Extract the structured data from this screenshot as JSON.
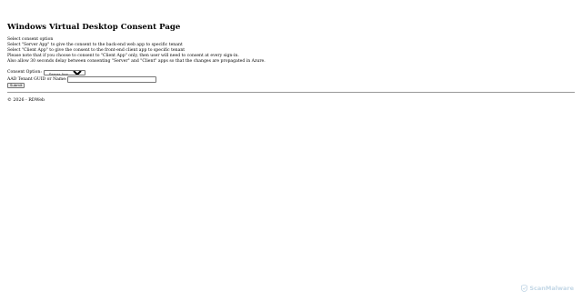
{
  "page": {
    "title": "Windows Virtual Desktop Consent Page"
  },
  "instructions": [
    "Select consent option",
    "Select \"Server App\" to give the consent to the back-end web app to specific tenant",
    "Select \"Client App\" to give the consent to the front-end client app to specific tenant",
    "Please note that if you choose to consent to \"Client App\" only, then user will need to consent at every sign-in.",
    "Also allow 30 seconds delay between consenting \"Server\" and \"Client\" apps so that the changes are propagated in Azure."
  ],
  "form": {
    "consent_label": "Consent Option:",
    "consent_selected": "Server App",
    "tenant_label": "AAD Tenant GUID or Name:",
    "tenant_value": "",
    "submit_label": "Submit"
  },
  "footer": {
    "text": "© 2026 - RDWeb"
  },
  "watermark": {
    "text": "ScanMalware",
    "icon": "shield-check-icon",
    "color": "#c3d7e6"
  }
}
